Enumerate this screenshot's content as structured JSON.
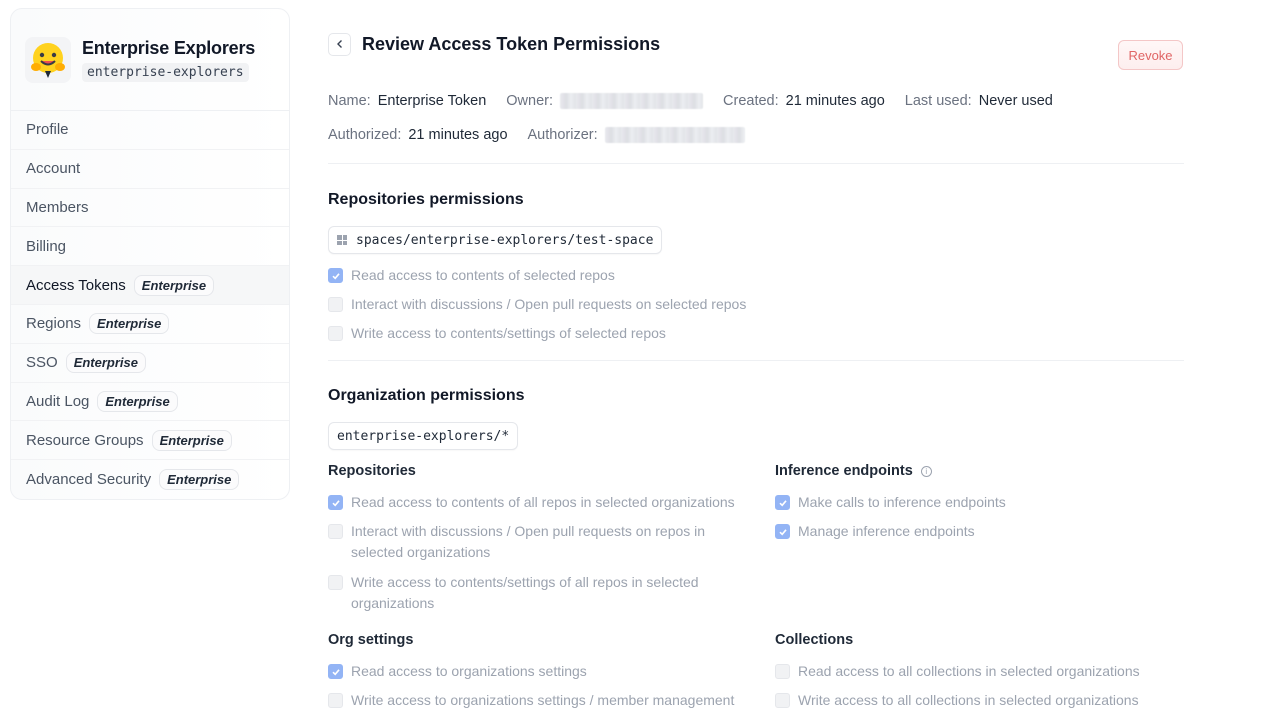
{
  "org": {
    "name": "Enterprise Explorers",
    "slug": "enterprise-explorers",
    "logo_icon": "hugging-face-emoji-icon"
  },
  "sidebar": {
    "items": [
      {
        "label": "Profile",
        "badge": ""
      },
      {
        "label": "Account",
        "badge": ""
      },
      {
        "label": "Members",
        "badge": ""
      },
      {
        "label": "Billing",
        "badge": ""
      },
      {
        "label": "Access Tokens",
        "badge": "Enterprise",
        "active": true
      },
      {
        "label": "Regions",
        "badge": "Enterprise"
      },
      {
        "label": "SSO",
        "badge": "Enterprise"
      },
      {
        "label": "Audit Log",
        "badge": "Enterprise"
      },
      {
        "label": "Resource Groups",
        "badge": "Enterprise"
      },
      {
        "label": "Advanced Security",
        "badge": "Enterprise"
      }
    ]
  },
  "header": {
    "title": "Review Access Token Permissions",
    "revoke_label": "Revoke"
  },
  "meta": {
    "name_label": "Name:",
    "name_value": "Enterprise Token",
    "owner_label": "Owner:",
    "created_label": "Created:",
    "created_value": "21 minutes ago",
    "last_used_label": "Last used:",
    "last_used_value": "Never used",
    "authorized_label": "Authorized:",
    "authorized_value": "21 minutes ago",
    "authorizer_label": "Authorizer:"
  },
  "repo_permissions": {
    "title": "Repositories permissions",
    "repo": "spaces/enterprise-explorers/test-space",
    "items": [
      {
        "label": "Read access to contents of selected repos",
        "checked": true
      },
      {
        "label": "Interact with discussions / Open pull requests on selected repos",
        "checked": false
      },
      {
        "label": "Write access to contents/settings of selected repos",
        "checked": false
      }
    ]
  },
  "org_permissions": {
    "title": "Organization permissions",
    "scope": "enterprise-explorers/*",
    "repositories": {
      "title": "Repositories",
      "items": [
        {
          "label": "Read access to contents of all repos in selected organizations",
          "checked": true
        },
        {
          "label_line1": "Interact with discussions / Open pull requests on repos in",
          "label_line2": "selected organizations",
          "checked": false
        },
        {
          "label_line1": "Write access to contents/settings of all repos in selected",
          "label_line2": "organizations",
          "checked": false
        }
      ]
    },
    "inference": {
      "title": "Inference endpoints",
      "info_icon": "info-icon",
      "items": [
        {
          "label": "Make calls to inference endpoints",
          "checked": true
        },
        {
          "label": "Manage inference endpoints",
          "checked": true
        }
      ]
    },
    "org_settings": {
      "title": "Org settings",
      "items": [
        {
          "label": "Read access to organizations settings",
          "checked": true
        },
        {
          "label": "Write access to organizations settings / member management",
          "checked": false
        }
      ]
    },
    "collections": {
      "title": "Collections",
      "items": [
        {
          "label": "Read access to all collections in selected organizations",
          "checked": false
        },
        {
          "label": "Write access to all collections in selected organizations",
          "checked": false
        }
      ]
    }
  },
  "colors": {
    "checked": "#93b4f5",
    "revoke_text": "#e06565"
  }
}
